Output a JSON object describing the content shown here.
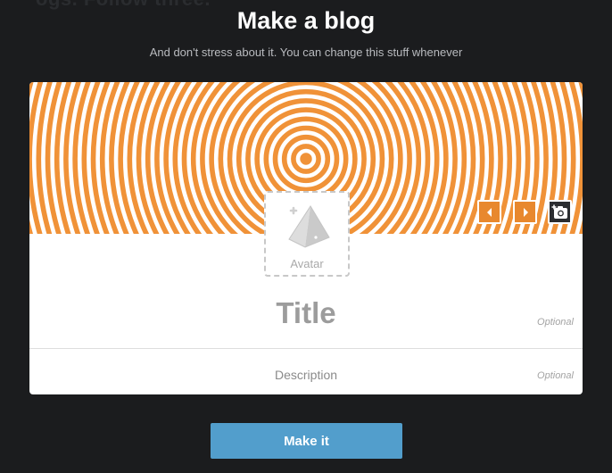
{
  "background_text": "ogs. Follow three.",
  "modal": {
    "title": "Make a blog",
    "subtitle": "And don't stress about it. You can change this stuff whenever"
  },
  "header_controls": {
    "prev_icon": "chevron-left-icon",
    "next_icon": "chevron-right-icon",
    "camera_icon": "camera-add-icon"
  },
  "avatar": {
    "label": "Avatar",
    "icon": "pyramid-add-icon"
  },
  "title_field": {
    "placeholder": "Title",
    "hint": "Optional"
  },
  "description_field": {
    "placeholder": "Description",
    "hint": "Optional"
  },
  "submit": {
    "label": "Make it"
  },
  "colors": {
    "accent_orange": "#e8882e",
    "button_blue": "#529ecc",
    "background": "#1b1c1e"
  }
}
